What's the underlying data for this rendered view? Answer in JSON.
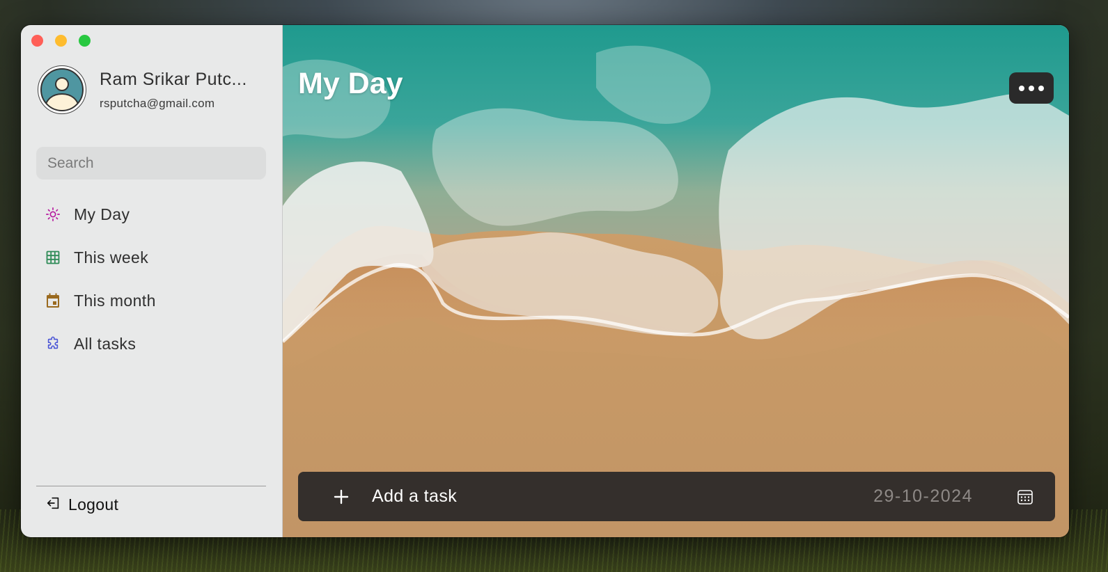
{
  "window": {
    "traffic_lights": [
      "close",
      "minimize",
      "maximize"
    ]
  },
  "profile": {
    "name": "Ram Srikar Putc...",
    "email": "rsputcha@gmail.com",
    "avatar_icon": "user-avatar-icon"
  },
  "search": {
    "placeholder": "Search",
    "value": ""
  },
  "sidebar": {
    "items": [
      {
        "label": "My Day",
        "icon": "sun-icon",
        "color": "#b5179e"
      },
      {
        "label": "This week",
        "icon": "grid-calendar-icon",
        "color": "#2e8b57"
      },
      {
        "label": "This month",
        "icon": "calendar-icon",
        "color": "#9a6a1f"
      },
      {
        "label": "All tasks",
        "icon": "puzzle-icon",
        "color": "#4b55d6"
      }
    ],
    "logout_label": "Logout"
  },
  "main": {
    "title": "My Day",
    "more_icon": "ellipsis-icon",
    "add_task": {
      "placeholder": "Add a task",
      "date": "29-10-2024",
      "plus_icon": "plus-icon",
      "calendar_icon": "calendar-icon"
    }
  },
  "colors": {
    "sidebar_bg": "#e8e9e9",
    "add_bar_bg": "#342f2c",
    "more_button_bg": "#2a2a2a"
  }
}
